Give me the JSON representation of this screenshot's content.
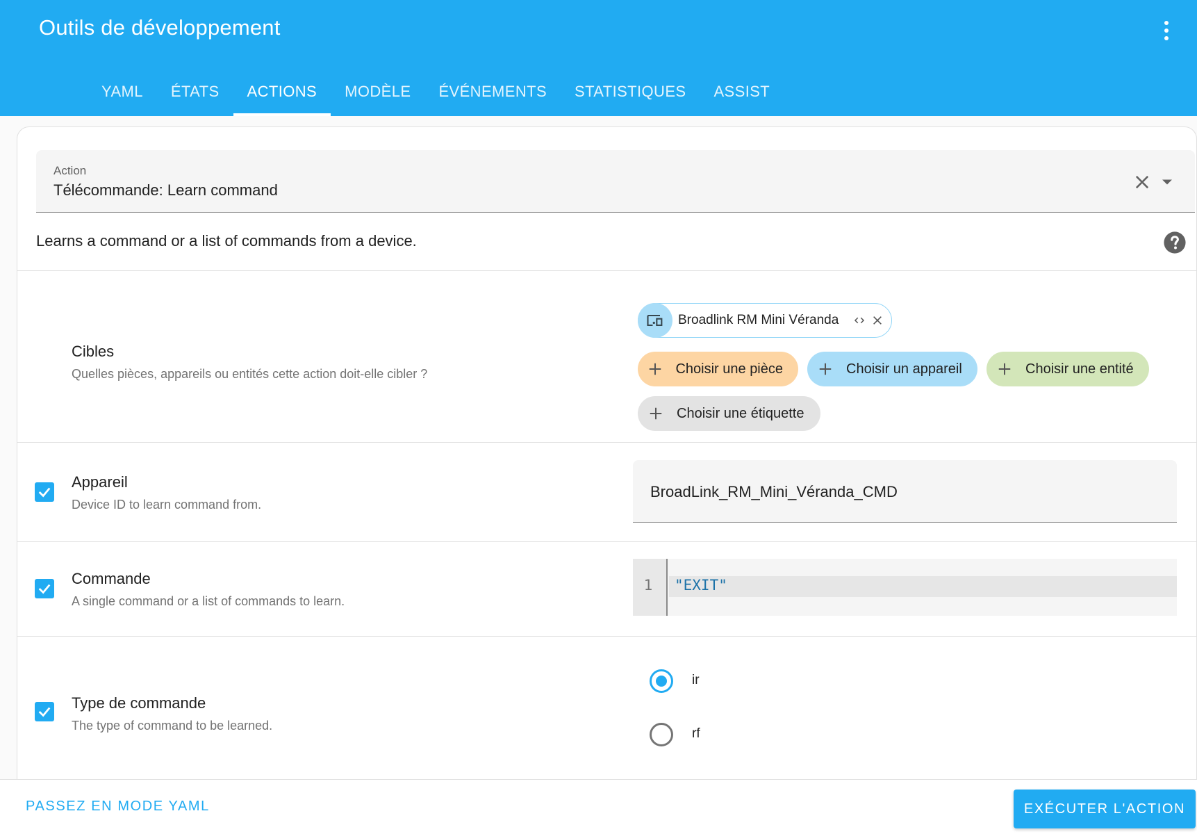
{
  "header": {
    "title": "Outils de développement",
    "menu_icon": "more-vertical-icon",
    "tabs": [
      {
        "label": "YAML"
      },
      {
        "label": "ÉTATS"
      },
      {
        "label": "ACTIONS",
        "active": true
      },
      {
        "label": "MODÈLE"
      },
      {
        "label": "ÉVÉNEMENTS"
      },
      {
        "label": "STATISTIQUES"
      },
      {
        "label": "ASSIST"
      }
    ]
  },
  "action": {
    "label": "Action",
    "value": "Télécommande: Learn command",
    "description": "Learns a command or a list of commands from a device."
  },
  "targets": {
    "title": "Cibles",
    "subtitle": "Quelles pièces, appareils ou entités cette action doit-elle cibler ?",
    "selected_device": "Broadlink RM Mini Véranda",
    "pickers": [
      {
        "label": "Choisir une pièce",
        "color": "#fdd5a3"
      },
      {
        "label": "Choisir un appareil",
        "color": "#a9ddf8"
      },
      {
        "label": "Choisir une entité",
        "color": "#d3e6b9"
      },
      {
        "label": "Choisir une étiquette",
        "color": "#e3e3e3"
      }
    ]
  },
  "fields": {
    "device": {
      "title": "Appareil",
      "subtitle": "Device ID to learn command from.",
      "value": "BroadLink_RM_Mini_Véranda_CMD",
      "checked": true
    },
    "command": {
      "title": "Commande",
      "subtitle": "A single command or a list of commands to learn.",
      "line_number": "1",
      "code": "\"EXIT\"",
      "checked": true
    },
    "command_type": {
      "title": "Type de commande",
      "subtitle": "The type of command to be learned.",
      "checked": true,
      "options": [
        {
          "label": "ir",
          "selected": true
        },
        {
          "label": "rf",
          "selected": false
        }
      ]
    }
  },
  "footer": {
    "yaml_mode_label": "PASSEZ EN MODE YAML",
    "run_label": "EXÉCUTER L'ACTION"
  },
  "colors": {
    "primary": "#21abf2",
    "area_chip": "#fdd5a3",
    "device_chip": "#a9ddf8",
    "entity_chip": "#d3e6b9",
    "label_chip": "#e3e3e3"
  }
}
